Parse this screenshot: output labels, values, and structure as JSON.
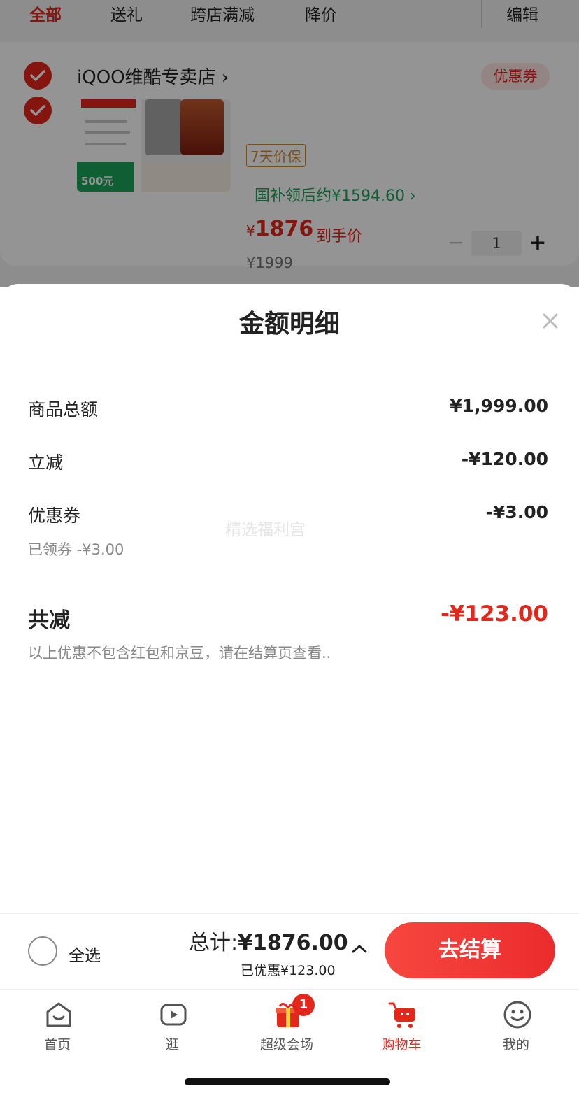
{
  "filter_tabs": [
    "全部",
    "送礼",
    "跨店满减",
    "降价"
  ],
  "edit_label": "编辑",
  "shop": {
    "name": "iQOO维酷专卖店 ›",
    "coupon_label": "优惠券"
  },
  "product": {
    "image_badge": "500元",
    "price_guard": "7天价保",
    "subsidy_text": "国补领后约¥1594.60 ›",
    "currency": "¥",
    "hand_price": "1876",
    "hand_price_label": "到手价",
    "original_price": "¥1999",
    "quantity": "1",
    "minus": "−",
    "plus": "+"
  },
  "sheet": {
    "title": "金额明细",
    "rows": [
      {
        "label": "商品总额",
        "value": "¥1,999.00"
      },
      {
        "label": "立减",
        "value": "-¥120.00"
      },
      {
        "label": "优惠券",
        "value": "-¥3.00",
        "sub": "已领券 -¥3.00"
      }
    ],
    "total_label": "共减",
    "total_value": "-¥123.00",
    "disclaimer": "以上优惠不包含红包和京豆，请在结算页查看..",
    "watermark": "精选福利宫"
  },
  "checkout": {
    "select_all": "全选",
    "total_prefix": "总计:",
    "total_amount": "¥1876.00",
    "saved": "已优惠¥123.00",
    "button": "去结算"
  },
  "tabbar": {
    "items": [
      {
        "label": "首页",
        "icon": "home-icon"
      },
      {
        "label": "逛",
        "icon": "video-icon"
      },
      {
        "label": "超级会场",
        "icon": "gift-icon",
        "badge": "1"
      },
      {
        "label": "购物车",
        "icon": "cart-icon",
        "active": true
      },
      {
        "label": "我的",
        "icon": "profile-icon"
      }
    ]
  },
  "colors": {
    "accent": "#e4271b",
    "green": "#1aa35a",
    "coupon_bg": "#fde6e4"
  }
}
